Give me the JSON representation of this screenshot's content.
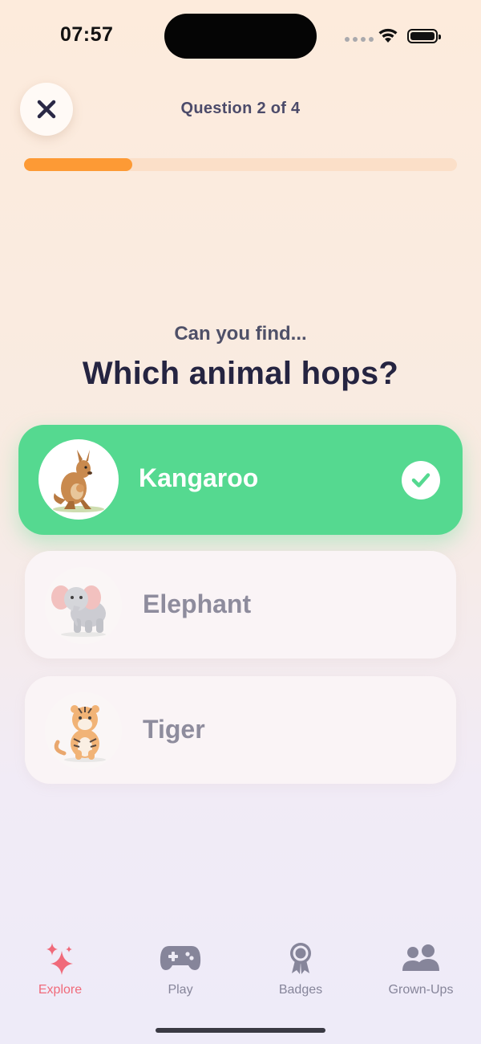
{
  "status_bar": {
    "time": "07:57"
  },
  "header": {
    "close_icon": "close-icon",
    "question_counter": "Question 2 of 4",
    "progress_fraction": 0.25
  },
  "prompt": {
    "subtitle": "Can you find...",
    "question": "Which animal hops?"
  },
  "options": [
    {
      "label": "Kangaroo",
      "image": "kangaroo-image",
      "state": "correct",
      "badge_icon": "checkmark-icon"
    },
    {
      "label": "Elephant",
      "image": "elephant-image",
      "state": "dimmed"
    },
    {
      "label": "Tiger",
      "image": "tiger-image",
      "state": "dimmed"
    }
  ],
  "tab_bar": [
    {
      "label": "Explore",
      "icon": "sparkles-icon",
      "active": true
    },
    {
      "label": "Play",
      "icon": "gamepad-icon",
      "active": false
    },
    {
      "label": "Badges",
      "icon": "medal-icon",
      "active": false
    },
    {
      "label": "Grown-Ups",
      "icon": "people-icon",
      "active": false
    }
  ],
  "colors": {
    "correct_green": "#55d990",
    "progress_orange": "#fd9a35",
    "active_tab": "#f06a7a",
    "title_dark": "#252441"
  }
}
